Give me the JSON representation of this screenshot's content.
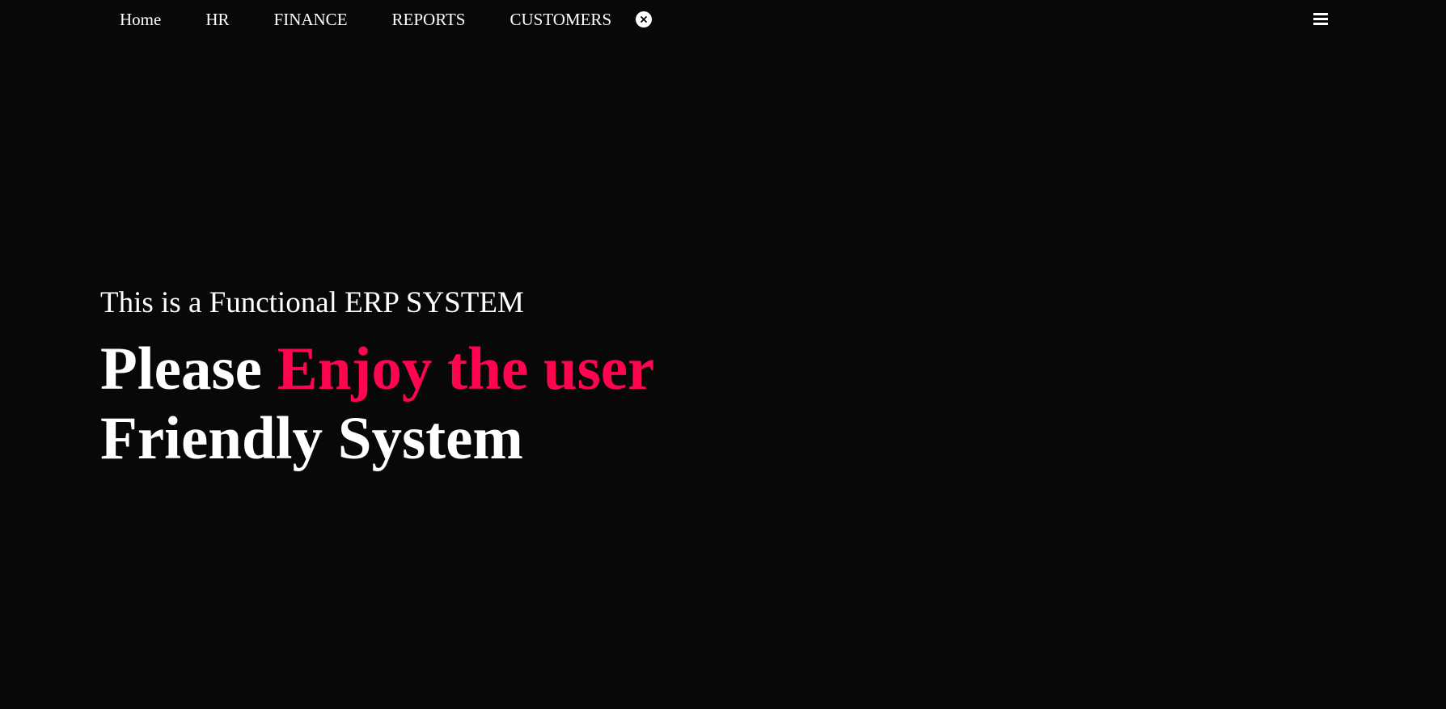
{
  "nav": {
    "items": [
      {
        "label": "Home"
      },
      {
        "label": "HR"
      },
      {
        "label": "FINANCE"
      },
      {
        "label": "REPORTS"
      },
      {
        "label": "CUSTOMERS"
      }
    ],
    "close_icon": "close-icon",
    "menu_icon": "hamburger-menu-icon"
  },
  "hero": {
    "subtitle": "This is a Functional ERP SYSTEM",
    "title_part1": "Please ",
    "title_accent": "Enjoy the user",
    "title_part2": "Friendly System"
  },
  "colors": {
    "background": "#080808",
    "text": "#ffffff",
    "accent": "#ff0550"
  }
}
